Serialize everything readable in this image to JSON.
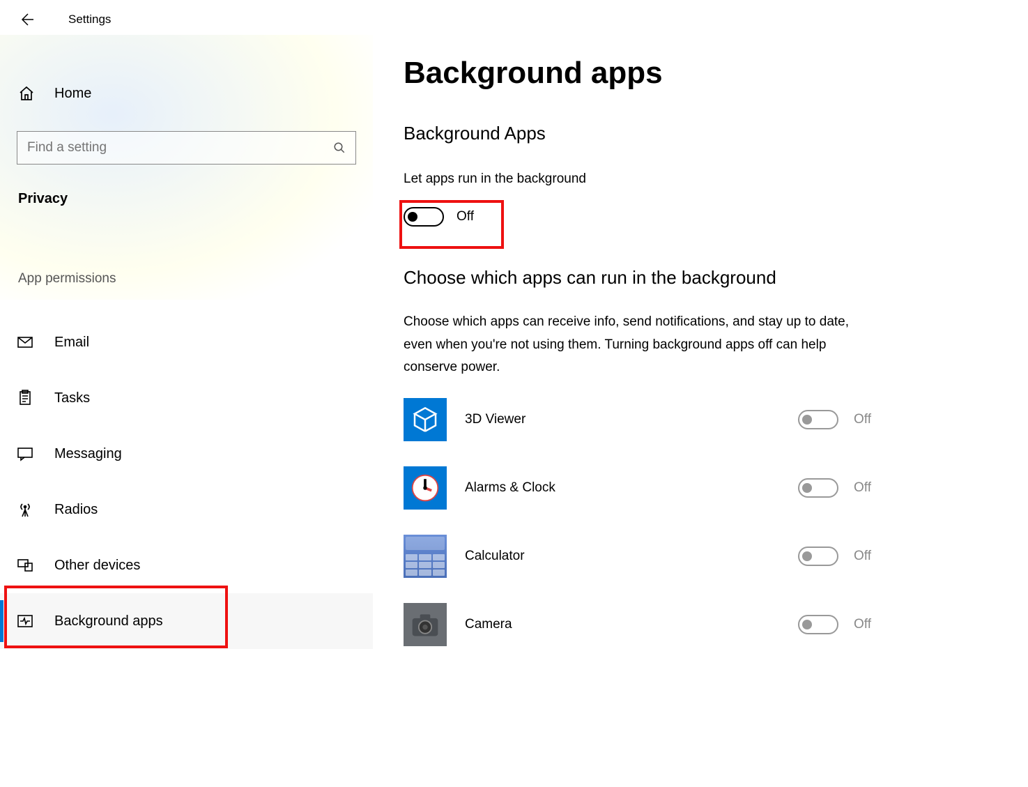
{
  "window": {
    "title": "Settings"
  },
  "sidebar": {
    "home_label": "Home",
    "search_placeholder": "Find a setting",
    "section": "Privacy",
    "subsection": "App permissions",
    "items": [
      {
        "label": "Email",
        "icon": "mail-icon"
      },
      {
        "label": "Tasks",
        "icon": "clipboard-icon"
      },
      {
        "label": "Messaging",
        "icon": "chat-icon"
      },
      {
        "label": "Radios",
        "icon": "radio-tower-icon"
      },
      {
        "label": "Other devices",
        "icon": "devices-icon"
      },
      {
        "label": "Background apps",
        "icon": "activity-icon",
        "active": true
      }
    ]
  },
  "main": {
    "heading": "Background apps",
    "section1_heading": "Background Apps",
    "toggle_description": "Let apps run in the background",
    "master_toggle_state": "Off",
    "section2_heading": "Choose which apps can run in the background",
    "section2_description": "Choose which apps can receive info, send notifications, and stay up to date, even when you're not using them. Turning background apps off can help conserve power.",
    "apps": [
      {
        "name": "3D Viewer",
        "state": "Off",
        "icon": "cube-icon",
        "bg": "#0078d4"
      },
      {
        "name": "Alarms & Clock",
        "state": "Off",
        "icon": "clock-icon",
        "bg": "#0078d4"
      },
      {
        "name": "Calculator",
        "state": "Off",
        "icon": "calculator-icon",
        "bg": "#5a7fc8"
      },
      {
        "name": "Camera",
        "state": "Off",
        "icon": "camera-icon",
        "bg": "#6a6e73"
      }
    ]
  },
  "colors": {
    "accent": "#0078d4",
    "highlight": "#e11"
  }
}
